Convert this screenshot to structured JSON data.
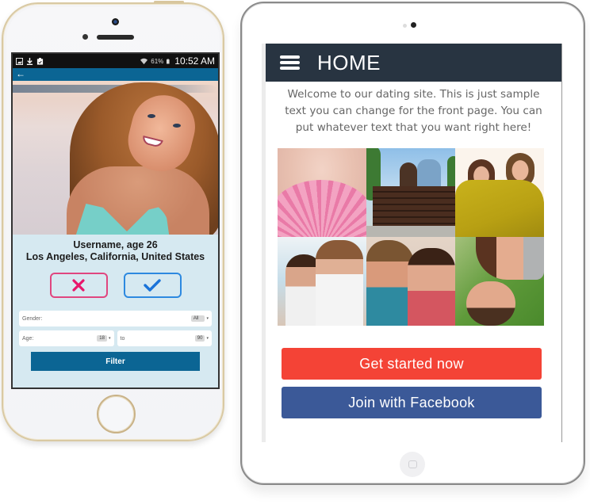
{
  "phone": {
    "status_bar": {
      "left_icons": [
        "gallery-icon",
        "download-icon",
        "clipboard-icon"
      ],
      "wifi_icon": "wifi-icon",
      "battery_percent": "61%",
      "battery_icon": "battery-icon",
      "time": "10:52 AM"
    },
    "app_bar": {
      "back_icon": "←"
    },
    "profile": {
      "name_age": "Username, age 26",
      "location": "Los Angeles, California, United States"
    },
    "actions": {
      "reject_icon": "✕",
      "accept_icon": "✓"
    },
    "filters": {
      "gender_label": "Gender:",
      "gender_value": "All",
      "age_label": "Age:",
      "age_min": "18",
      "to_label": "to",
      "age_max": "90",
      "caret": "▾",
      "filter_button": "Filter"
    }
  },
  "tablet": {
    "header": {
      "title": "HOME"
    },
    "welcome_text": "Welcome to our dating site. This is just sample text you can change for the front page. You can put whatever text that you want right here!",
    "gallery": [
      {
        "caption": "woman-with-pink-flower"
      },
      {
        "caption": "couple-on-park-bench"
      },
      {
        "caption": "couple-in-yellow-blanket"
      },
      {
        "caption": "couple-at-beach"
      },
      {
        "caption": "couple-embracing"
      },
      {
        "caption": "couple-lying-on-grass"
      }
    ],
    "buttons": {
      "get_started": "Get started now",
      "facebook": "Join with Facebook"
    }
  },
  "colors": {
    "phone_app_bar": "#0b6594",
    "phone_bg": "#d6e9f1",
    "reject": "#e0467f",
    "accept": "#2d89e0",
    "tablet_header": "#283441",
    "get_started": "#f44336",
    "facebook": "#3b5998"
  }
}
